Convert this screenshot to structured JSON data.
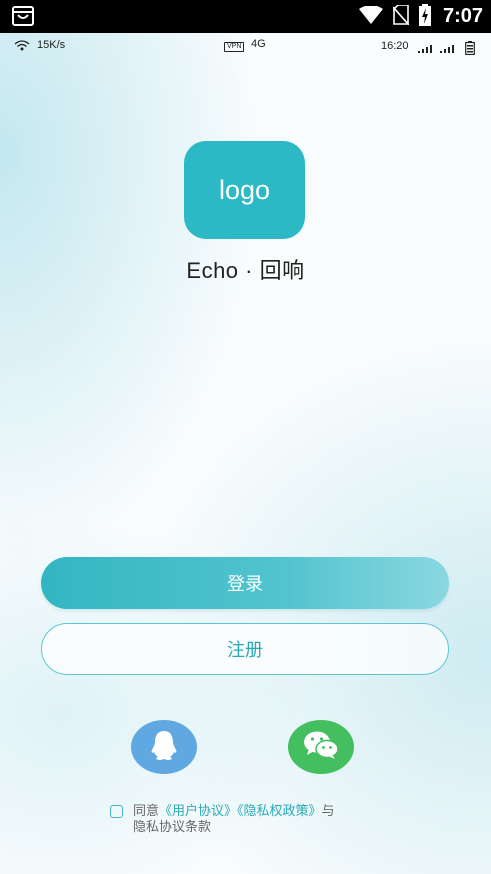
{
  "system_bar": {
    "time": "7:07",
    "icons": [
      "shopping-bag-icon",
      "wifi-icon",
      "no-sim-icon",
      "battery-charging-icon"
    ]
  },
  "inner_status_bar": {
    "net_speed": "15K/s",
    "vpn": "VPN",
    "network": "4G",
    "time": "16:20"
  },
  "logo": {
    "text": "logo",
    "color": "#2cb9c5"
  },
  "app_name": "Echo · 回响",
  "buttons": {
    "login": "登录",
    "register": "注册"
  },
  "social_login": [
    "qq-icon",
    "wechat-icon"
  ],
  "agreement": {
    "prefix": "同意",
    "user_agreement": "《用户协议》",
    "privacy_policy": "《隐私权政策》",
    "connector": "与",
    "line2": "隐私协议条款",
    "checked": false
  },
  "colors": {
    "accent": "#2cb9c5",
    "qq": "#5fa8e2",
    "wechat": "#43bf5f"
  }
}
